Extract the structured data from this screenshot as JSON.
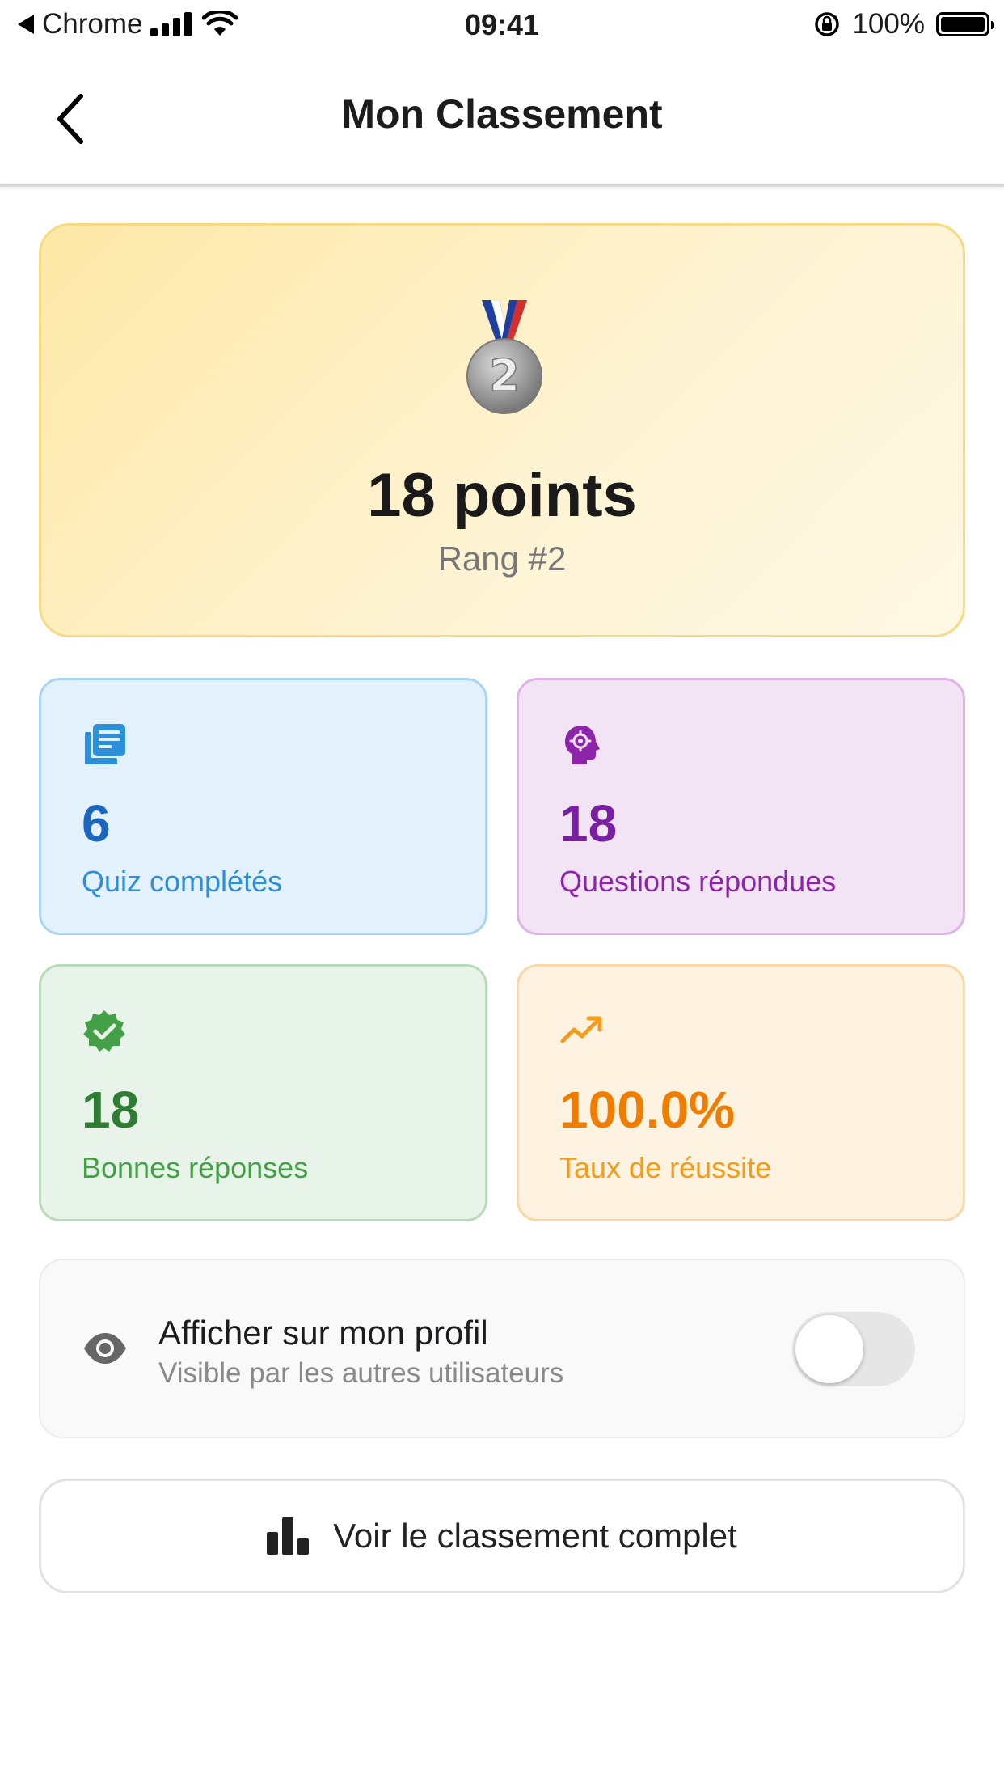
{
  "status_bar": {
    "back_app": "Chrome",
    "time": "09:41",
    "battery": "100%"
  },
  "header": {
    "title": "Mon Classement",
    "back_icon": "chevron-left-icon"
  },
  "rank_card": {
    "medal_icon": "silver-medal-icon",
    "medal_number": "2",
    "points": "18 points",
    "rank": "Rang #2",
    "background_color": "#fde8a6",
    "border_color": "#f7db82"
  },
  "stats": [
    {
      "icon": "quiz-library-icon",
      "value": "6",
      "label": "Quiz complétés",
      "color": "#1b65bf"
    },
    {
      "icon": "psychology-head-icon",
      "value": "18",
      "label": "Questions répondues",
      "color": "#7b1fa2"
    },
    {
      "icon": "verified-check-icon",
      "value": "18",
      "label": "Bonnes réponses",
      "color": "#2e7d32"
    },
    {
      "icon": "trending-up-icon",
      "value": "100.0%",
      "label": "Taux de réussite",
      "color": "#ef7d00"
    }
  ],
  "profile_visibility": {
    "icon": "eye-icon",
    "title": "Afficher sur mon profil",
    "subtitle": "Visible par les autres utilisateurs",
    "enabled": false
  },
  "full_ranking_button": {
    "icon": "bar-chart-icon",
    "label": "Voir le classement complet"
  }
}
